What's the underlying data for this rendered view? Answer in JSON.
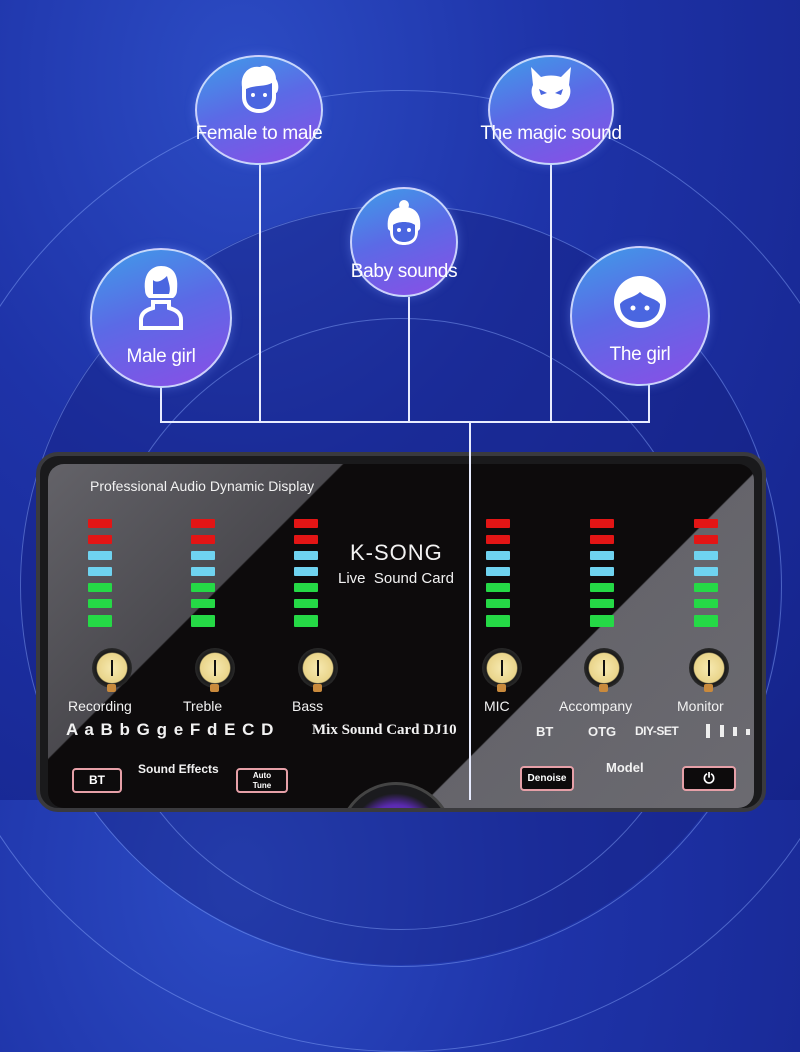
{
  "effects": [
    {
      "id": "female-to-male",
      "label": "Female to male",
      "icon": "boy-face-icon"
    },
    {
      "id": "magic-sound",
      "label": "The magic sound",
      "icon": "devil-face-icon"
    },
    {
      "id": "baby-sounds",
      "label": "Baby sounds",
      "icon": "baby-face-icon"
    },
    {
      "id": "male-girl",
      "label": "Male girl",
      "icon": "woman-bust-icon"
    },
    {
      "id": "the-girl",
      "label": "The girl",
      "icon": "girl-face-icon"
    }
  ],
  "device": {
    "display_title": "Professional Audio Dynamic Display",
    "brand": "K-SONG",
    "subtitle": "Live  Sound Card",
    "meter_colors": {
      "red": "#e31515",
      "blue": "#6fd3f0",
      "green": "#25d946"
    },
    "meter_levels": [
      7,
      7,
      7,
      7,
      7,
      7
    ],
    "knobs": [
      {
        "label": "Recording"
      },
      {
        "label": "Treble"
      },
      {
        "label": "Bass"
      },
      {
        "label": "MIC"
      },
      {
        "label": "Accompany"
      },
      {
        "label": "Monitor"
      }
    ],
    "effect_keys": "A a B b G g e F d E C D",
    "model_name": "Mix Sound Card DJ10",
    "modes": [
      "BT",
      "OTG",
      "DIY-SET"
    ],
    "sound_effects_label": "Sound Effects",
    "model_label": "Model",
    "buttons": {
      "bt": "BT",
      "auto_tune_1": "Auto",
      "auto_tune_2": "Tune",
      "denoise": "Denoise",
      "power": "⏻"
    }
  }
}
